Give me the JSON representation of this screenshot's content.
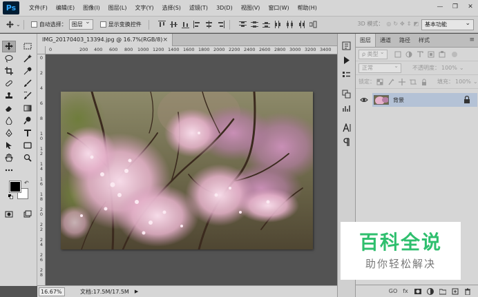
{
  "app": {
    "logo": "Ps"
  },
  "menu": [
    "文件(F)",
    "编辑(E)",
    "图像(I)",
    "图层(L)",
    "文字(Y)",
    "选择(S)",
    "滤镜(T)",
    "3D(D)",
    "视图(V)",
    "窗口(W)",
    "帮助(H)"
  ],
  "window_controls": {
    "minimize": "—",
    "restore": "❐",
    "close": "✕"
  },
  "options": {
    "auto_select_label": "自动选择：",
    "auto_select_value": "图层",
    "show_transform_label": "显示变换控件",
    "mode_3d_label": "3D 模式：",
    "workspace": "基本功能"
  },
  "document": {
    "tab_title": "IMG_20170403_13394.jpg @ 16.7%(RGB/8)",
    "tab_close": "×",
    "ruler_h": [
      "0",
      "200",
      "400",
      "600",
      "800",
      "1000",
      "1200",
      "1400",
      "1600",
      "1800",
      "2000",
      "2200",
      "2400",
      "2600",
      "2800",
      "3000",
      "3200",
      "3400",
      "3600",
      "3800",
      "400"
    ],
    "ruler_v": [
      "0",
      "2",
      "4",
      "6",
      "8",
      "1 0",
      "1 2",
      "1 4",
      "1 6",
      "1 8",
      "2 0",
      "2 2",
      "2 4",
      "2 6",
      "2 8"
    ]
  },
  "status": {
    "zoom": "16.67%",
    "doc_size": "文档:17.5M/17.5M",
    "arrow": "▶"
  },
  "layers_panel": {
    "tabs": [
      "图层",
      "通道",
      "路径",
      "样式"
    ],
    "menu_icon": "≡",
    "kind_filter": "ρ 类型",
    "blend_mode": "正常",
    "opacity_label": "不透明度：",
    "opacity_value": "100%",
    "lock_label": "锁定：",
    "fill_label": "填充：",
    "fill_value": "100%",
    "layer_name": "背景",
    "footer_link": "GO",
    "footer_fx": "fx"
  },
  "watermark": {
    "title": "百科全说",
    "subtitle": "助你轻松解决"
  }
}
